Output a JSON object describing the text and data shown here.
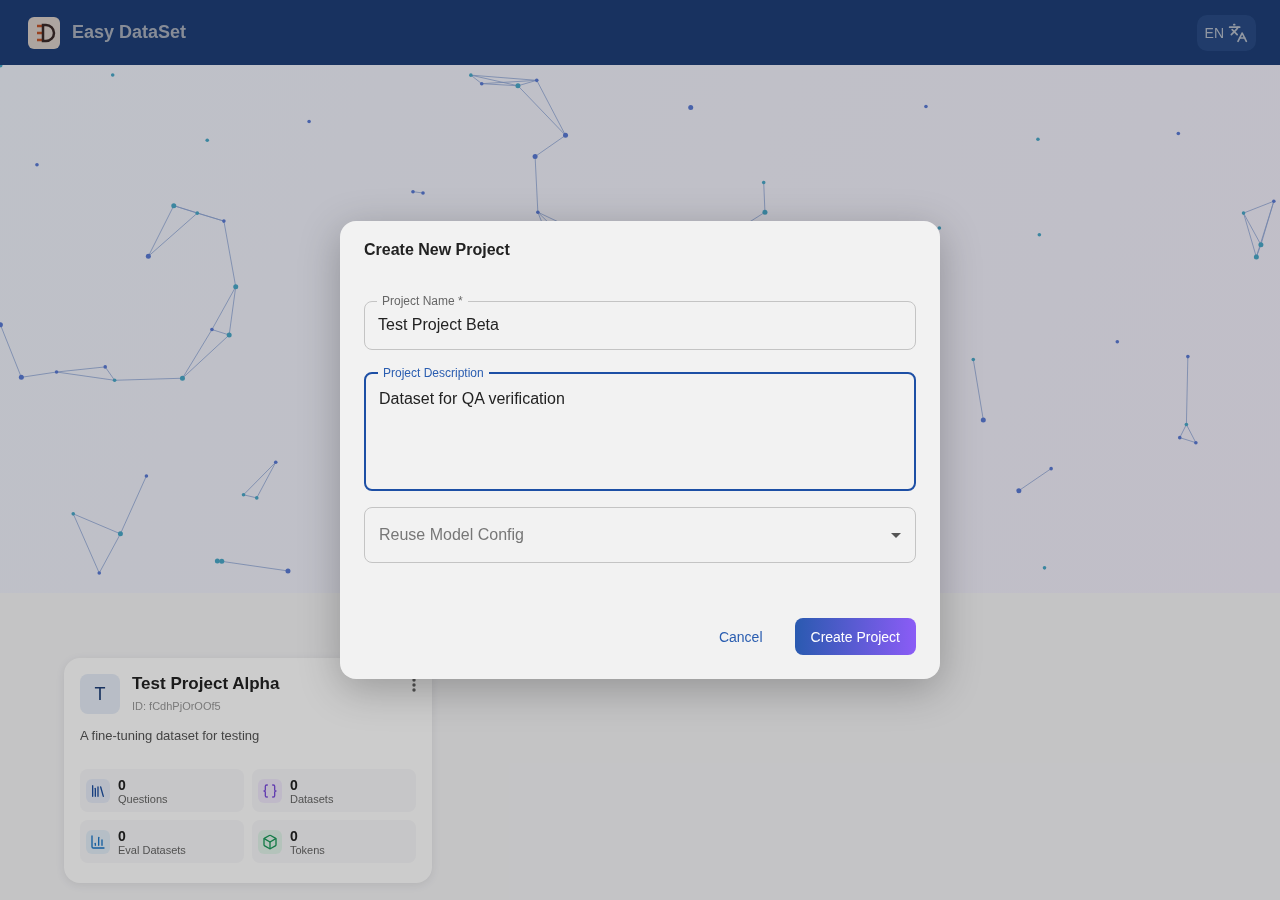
{
  "app": {
    "title": "Easy DataSet",
    "language": "EN"
  },
  "project_card": {
    "avatar": "T",
    "name": "Test Project Alpha",
    "id": "ID: fCdhPjOrOOf5",
    "description": "A fine-tuning dataset for testing",
    "stats": [
      {
        "kind": "questions",
        "value": "0",
        "label": "Questions"
      },
      {
        "kind": "datasets",
        "value": "0",
        "label": "Datasets"
      },
      {
        "kind": "eval",
        "value": "0",
        "label": "Eval Datasets"
      },
      {
        "kind": "tokens",
        "value": "0",
        "label": "Tokens"
      }
    ]
  },
  "dialog": {
    "title": "Create New Project",
    "fields": [
      {
        "kind": "text",
        "label": "Project Name *",
        "value": "Test Project Beta",
        "focused": false
      },
      {
        "kind": "textarea",
        "label": "Project Description",
        "value": "Dataset for QA verification",
        "focused": true
      },
      {
        "kind": "select",
        "placeholder": "Reuse Model Config",
        "focused": false
      }
    ],
    "buttons": [
      {
        "kind": "text",
        "label": "Cancel"
      },
      {
        "kind": "primary",
        "label": "Create Project"
      }
    ]
  }
}
